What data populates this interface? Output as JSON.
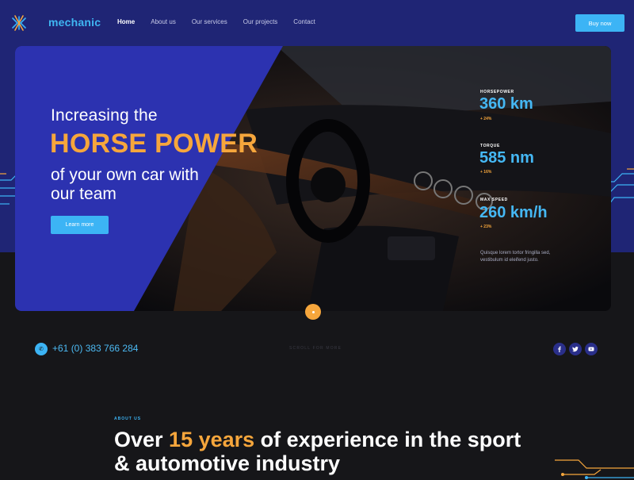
{
  "header": {
    "logo_text": "mechanic",
    "nav": [
      {
        "label": "Home",
        "active": true
      },
      {
        "label": "About us",
        "active": false
      },
      {
        "label": "Our services",
        "active": false
      },
      {
        "label": "Our projects",
        "active": false
      },
      {
        "label": "Contact",
        "active": false
      }
    ],
    "buy_label": "Buy now"
  },
  "hero": {
    "line1": "Increasing the",
    "line2": "HORSE POWER",
    "line3": "of your own car with our team",
    "button": "Learn more",
    "stats": [
      {
        "label": "HORSEPOWER",
        "value": "360 km",
        "change": "+ 24%"
      },
      {
        "label": "TORQUE",
        "value": "585 nm",
        "change": "+ 16%"
      },
      {
        "label": "MAX SPEED",
        "value": "260 km/h",
        "change": "+ 23%"
      }
    ],
    "description": "Quisque lorem tortor fringilla sed, vestibulum id eleifend justo."
  },
  "contact": {
    "phone": "+61 (0) 383 766 284",
    "scroll_text": "SCROLL FOR MORE",
    "social": [
      "facebook-icon",
      "twitter-icon",
      "youtube-icon"
    ]
  },
  "about": {
    "label": "ABOUT US",
    "heading_pre": "Over ",
    "heading_accent": "15 years",
    "heading_post": " of experience in the sport & automotive industry"
  },
  "colors": {
    "navy": "#1f2575",
    "accent_blue": "#3cb4f5",
    "accent_orange": "#f6a63c",
    "dark": "#161619"
  }
}
